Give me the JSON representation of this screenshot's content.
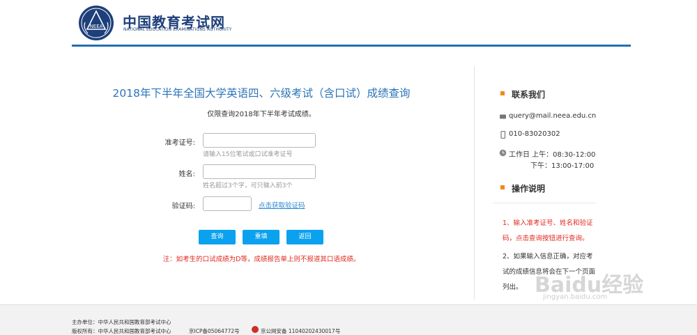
{
  "header": {
    "logo_text": "NEEA",
    "site_name_cn": "中国教育考试网",
    "site_name_en": "NATIONAL EDUCATION EXAMINATIONS AUTHORITY"
  },
  "form": {
    "title": "2018年下半年全国大学英语四、六级考试（含口试）成绩查询",
    "subtitle": "仅限查询2018年下半年考试成绩。",
    "exam_id_label": "准考证号:",
    "exam_id_value": "",
    "exam_id_hint": "请输入15位笔试或口试准考证号",
    "name_label": "姓名:",
    "name_value": "",
    "name_hint": "姓名超过3个字，可只输入前3个",
    "captcha_label": "验证码:",
    "captcha_value": "",
    "captcha_link": "点击获取验证码",
    "query_button": "查询",
    "reset_button": "重填",
    "back_button": "返回",
    "note": "注：如考生的口试成绩为D等，成绩报告单上则不报道其口语成绩。"
  },
  "contact": {
    "title": "联系我们",
    "email": "query@mail.neea.edu.cn",
    "phone": "010-83020302",
    "hours_line1": "工作日 上午：08:30-12:00",
    "hours_line2": "下午：13:00-17:00"
  },
  "instructions": {
    "title": "操作说明",
    "step1_lines": [
      "1、输入准考证号、姓名和验证",
      "码，点击查询按钮进行查询。"
    ],
    "step2_lines": [
      "2、如果输入信息正确，对应考",
      "试的成绩信息将会在下一个页面",
      "列出。"
    ]
  },
  "footer": {
    "sponsor": "主办单位：中华人民共和国教育部考试中心",
    "copyright": "版权所有：中华人民共和国教育部考试中心",
    "icp": "京ICP备05064772号",
    "police": "京公网安备 11040202430017号"
  },
  "watermark": {
    "brand": "Baidu经验",
    "url": "jingyan.baidu.com"
  },
  "colors": {
    "brand_blue": "#1d3f7a",
    "title_blue": "#2b74b8",
    "button_blue": "#0aa1ee",
    "accent_orange": "#f08a15",
    "alert_red": "#e02a20"
  }
}
